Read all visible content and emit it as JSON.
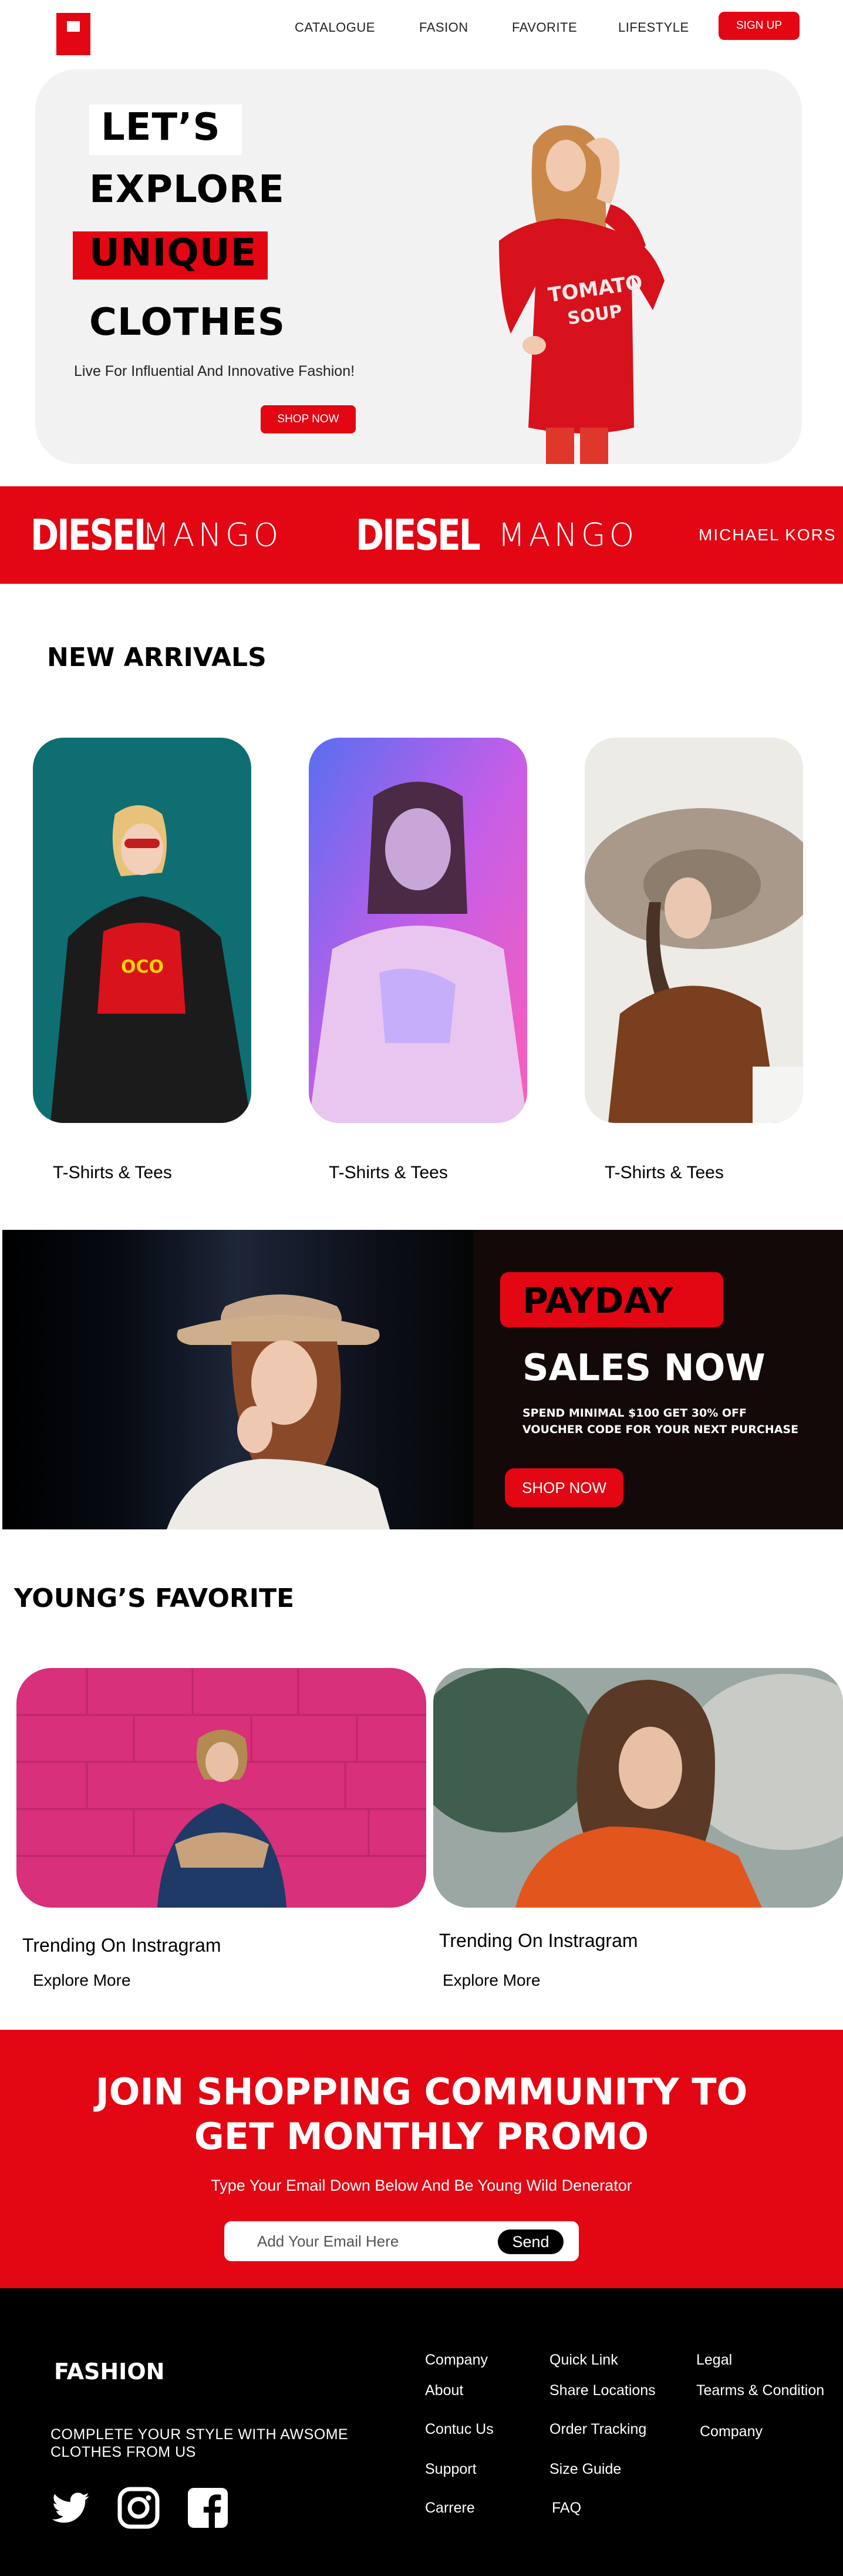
{
  "nav": {
    "items": [
      "CATALOGUE",
      "FASION",
      "FAVORITE",
      "LIFESTYLE"
    ],
    "signup": "SIGN UP"
  },
  "hero": {
    "line1": "LET’S",
    "line2": "EXPLORE",
    "line3": "UNIQUE",
    "line4": "CLOTHES",
    "subtitle": "Live For Influential And Innovative Fashion!",
    "cta": "SHOP NOW",
    "shirt_text_1": "TOMATO",
    "shirt_text_2": "SOUP"
  },
  "brands": [
    "DIESEL",
    "MANGO",
    "DIESEL",
    "MANGO",
    "MICHAEL KORS"
  ],
  "new_arrivals": {
    "title": "NEW ARRIVALS",
    "items": [
      {
        "label": "T-Shirts & Tees"
      },
      {
        "label": "T-Shirts & Tees"
      },
      {
        "label": "T-Shirts & Tees"
      }
    ]
  },
  "payday": {
    "tag": "PAYDAY",
    "headline": "SALES NOW",
    "desc_line1": "SPEND MINIMAL $100 GET 30% OFF",
    "desc_line2": "VOUCHER CODE FOR YOUR NEXT PURCHASE",
    "cta": "SHOP NOW"
  },
  "favorite": {
    "title": "YOUNG’S FAVORITE",
    "items": [
      {
        "title": "Trending On Instragram",
        "link": "Explore More"
      },
      {
        "title": "Trending On Instragram",
        "link": "Explore More"
      }
    ]
  },
  "join": {
    "title_line1": "JOIN SHOPPING COMMUNITY TO",
    "title_line2": "GET MONTHLY PROMO",
    "subtitle": "Type Your Email Down Below And Be Young Wild Denerator",
    "placeholder": "Add Your Email Here",
    "send": "Send"
  },
  "footer": {
    "brand": "FASHION",
    "tagline_line1": "COMPLETE YOUR STYLE WITH AWSOME",
    "tagline_line2": "CLOTHES FROM US",
    "col1": [
      "Company",
      "About",
      "Contuc Us",
      "Support",
      "Carrere"
    ],
    "col2": [
      "Quick Link",
      "Share Locations",
      "Order Tracking",
      "Size Guide",
      "FAQ"
    ],
    "col3": [
      "Legal",
      "Tearms & Condition",
      "Company"
    ],
    "social_icons": [
      "twitter-icon",
      "instagram-icon",
      "facebook-icon"
    ]
  },
  "colors": {
    "accent": "#e30613",
    "dark": "#000000"
  }
}
